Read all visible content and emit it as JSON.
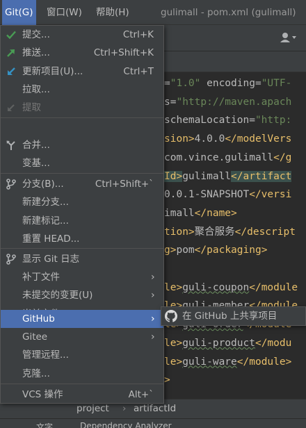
{
  "menubar": {
    "items": [
      {
        "label": "Git(G)"
      },
      {
        "label": "窗口(W)"
      },
      {
        "label": "帮助(H)"
      }
    ],
    "window_title": "gulimall - pom.xml (gulimall)"
  },
  "editor": {
    "lines": [
      {
        "parts": [
          [
            "p",
            "=\"1.0\" encoding=\"UTF-"
          ]
        ]
      },
      {
        "parts": [
          [
            "p",
            "s=\"http://maven.apach"
          ]
        ]
      },
      {
        "parts": [
          [
            "p",
            "schemaLocation=\"http:"
          ]
        ]
      },
      {
        "parts": [
          [
            "t",
            "sion>"
          ],
          [
            "p",
            "4.0.0"
          ],
          [
            "t",
            "</modelVers"
          ]
        ]
      },
      {
        "parts": [
          [
            "p",
            "com.vince.gulimall"
          ],
          [
            "t",
            "</g"
          ]
        ]
      },
      {
        "parts": [
          [
            "th",
            "Id>"
          ],
          [
            "p",
            "gulimall"
          ],
          [
            "th",
            "</artifact"
          ]
        ]
      },
      {
        "parts": [
          [
            "p",
            "0.0.1-SNAPSHOT"
          ],
          [
            "t",
            "</versi"
          ]
        ]
      },
      {
        "parts": [
          [
            "p",
            "imall"
          ],
          [
            "t",
            "</name>"
          ]
        ]
      },
      {
        "parts": [
          [
            "t",
            "tion>"
          ],
          [
            "p",
            "聚合服务"
          ],
          [
            "t",
            "</descript"
          ]
        ]
      },
      {
        "parts": [
          [
            "t",
            "g>"
          ],
          [
            "p",
            "pom"
          ],
          [
            "t",
            "</packaging>"
          ]
        ]
      },
      {
        "parts": []
      },
      {
        "parts": [
          [
            "t",
            "le>"
          ],
          [
            "q",
            "guli-coupon"
          ],
          [
            "t",
            "</module"
          ]
        ]
      },
      {
        "parts": [
          [
            "t",
            "le>"
          ],
          [
            "q",
            "guli-member"
          ],
          [
            "t",
            "</module"
          ]
        ]
      },
      {
        "parts": [
          [
            "t",
            "le>"
          ],
          [
            "q",
            "guli-order"
          ],
          [
            "t",
            "</module"
          ]
        ]
      },
      {
        "parts": [
          [
            "t",
            "le>"
          ],
          [
            "q",
            "guli-product"
          ],
          [
            "t",
            "</modu"
          ]
        ]
      },
      {
        "parts": [
          [
            "t",
            "le>"
          ],
          [
            "q",
            "guli-ware"
          ],
          [
            "t",
            "</module>"
          ]
        ]
      },
      {
        "parts": [
          [
            "t",
            ">"
          ]
        ]
      }
    ]
  },
  "breadcrumb": {
    "items": [
      "project",
      "artifactId"
    ]
  },
  "bottom_bar": {
    "items": [
      "文字",
      "Dependency Analyzer"
    ]
  },
  "git_menu": {
    "items": [
      {
        "label": "提交...",
        "shortcut": "Ctrl+K",
        "icon": "check-icon"
      },
      {
        "label": "推送...",
        "shortcut": "Ctrl+Shift+K",
        "icon": "push-arrow-icon"
      },
      {
        "label": "更新项目(U)...",
        "shortcut": "Ctrl+T",
        "icon": "update-arrow-icon"
      },
      {
        "label": "拉取...",
        "shortcut": ""
      },
      {
        "label": "提取",
        "shortcut": "",
        "icon": "fetch-icon",
        "disabled": true
      },
      {
        "label": "合并...",
        "shortcut": "",
        "icon": "merge-icon"
      },
      {
        "label": "变基...",
        "shortcut": ""
      },
      {
        "label": "分支(B)...",
        "shortcut": "Ctrl+Shift+`",
        "icon": "branch-icon"
      },
      {
        "label": "新建分支...",
        "shortcut": ""
      },
      {
        "label": "新建标记...",
        "shortcut": ""
      },
      {
        "label": "重置 HEAD...",
        "shortcut": ""
      },
      {
        "label": "显示 Git 日志",
        "shortcut": "",
        "icon": "git-log-icon"
      },
      {
        "label": "补丁文件",
        "shortcut": "",
        "submenu": true
      },
      {
        "label": "未提交的变更(U)",
        "shortcut": "",
        "submenu": true
      },
      {
        "label": "当前文件",
        "shortcut": "",
        "submenu": true
      },
      {
        "label": "GitHub",
        "shortcut": "",
        "submenu": true,
        "highlighted": true
      },
      {
        "label": "Gitee",
        "shortcut": "",
        "submenu": true
      },
      {
        "label": "管理远程...",
        "shortcut": ""
      },
      {
        "label": "克隆...",
        "shortcut": ""
      },
      {
        "label": "VCS 操作",
        "shortcut": "Alt+`"
      }
    ]
  },
  "github_submenu": {
    "item_label": "在 GitHub 上共享项目",
    "icon": "github-icon"
  },
  "colors": {
    "menu_bg": "#3c3f41",
    "highlight": "#4b6eaf",
    "editor_bg": "#2b2b2b",
    "xml_tag": "#e8bf6a",
    "xml_string": "#6a8759",
    "check_green": "#499c54",
    "update_blue": "#3592c4"
  }
}
